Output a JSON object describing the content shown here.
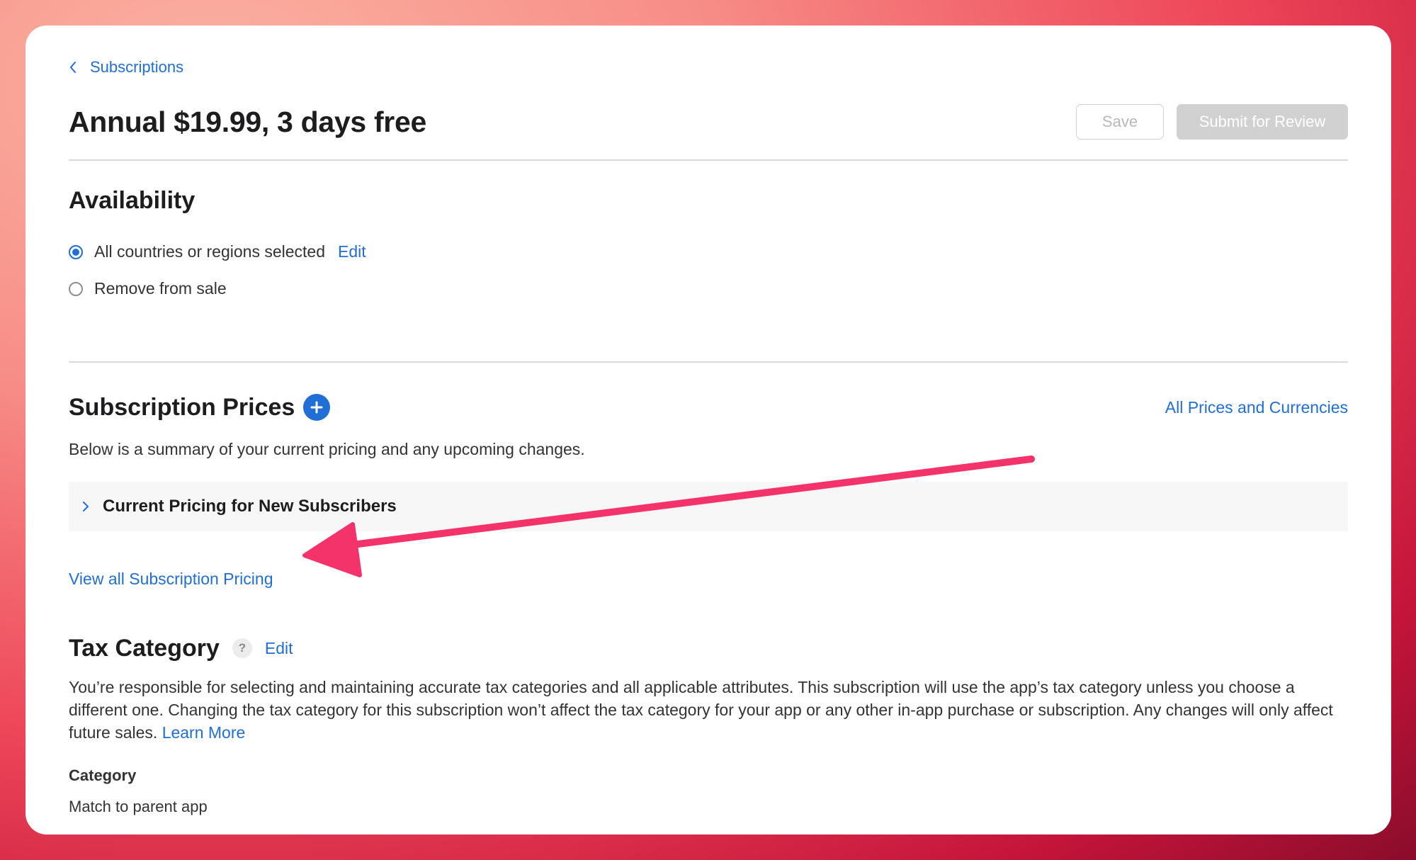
{
  "breadcrumb": {
    "label": "Subscriptions",
    "icon": "chevron-left-icon"
  },
  "header": {
    "title": "Annual $19.99, 3 days free",
    "save_label": "Save",
    "submit_label": "Submit for Review"
  },
  "availability": {
    "heading": "Availability",
    "options": [
      {
        "label": "All countries or regions selected",
        "checked": true,
        "edit_label": "Edit"
      },
      {
        "label": "Remove from sale",
        "checked": false
      }
    ]
  },
  "prices": {
    "heading": "Subscription Prices",
    "all_prices_link": "All Prices and Currencies",
    "summary": "Below is a summary of your current pricing and any upcoming changes.",
    "current_pricing_label": "Current Pricing for New Subscribers",
    "view_all_link": "View all Subscription Pricing"
  },
  "tax": {
    "heading": "Tax Category",
    "help_glyph": "?",
    "edit_label": "Edit",
    "description": "You’re responsible for selecting and maintaining accurate tax categories and all applicable attributes. This subscription will use the app’s tax category unless you choose a different one. Changing the tax category for this subscription won’t affect the tax category for your app or any other in-app purchase or subscription. Any changes will only affect future sales.",
    "learn_more": "Learn More",
    "category_label": "Category",
    "category_value": "Match to parent app"
  },
  "colors": {
    "accent": "#1f6fd6",
    "annotation_arrow": "#f4336b",
    "disabled_button": "#d1d1d1"
  }
}
